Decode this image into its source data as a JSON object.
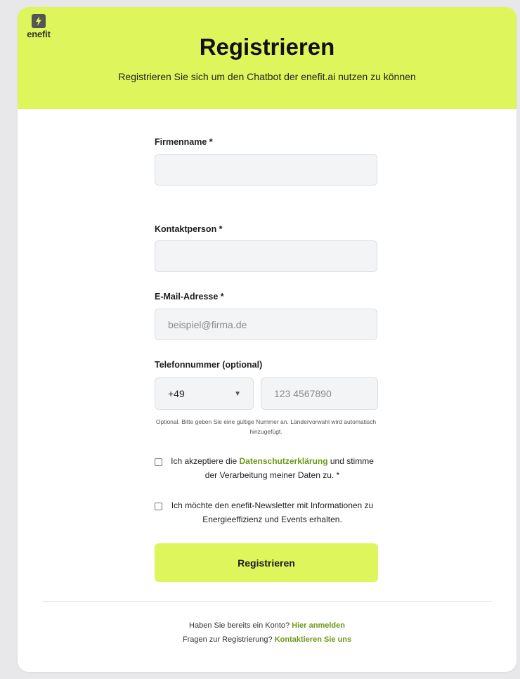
{
  "brand": {
    "logo_text": "enefit"
  },
  "header": {
    "title": "Registrieren",
    "subtitle": "Registrieren Sie sich um den Chatbot der enefit.ai nutzen zu können"
  },
  "form": {
    "company": {
      "label": "Firmenname *",
      "value": "",
      "placeholder": ""
    },
    "contact": {
      "label": "Kontaktperson *",
      "value": "",
      "placeholder": ""
    },
    "email": {
      "label": "E-Mail-Adresse *",
      "value": "",
      "placeholder": "beispiel@firma.de"
    },
    "phone": {
      "label": "Telefonnummer (optional)",
      "country_code": "+49",
      "value": "",
      "placeholder": "123 4567890",
      "hint": "Optional. Bitte geben Sie eine gültige Nummer an. Ländervorwahl wird automatisch hinzugefügt."
    },
    "privacy_consent": {
      "checked": false,
      "text_before": "Ich akzeptiere die ",
      "link_text": "Datenschutzerklärung",
      "text_after": " und stimme der Verarbeitung meiner Daten zu. *"
    },
    "newsletter_consent": {
      "checked": false,
      "text": "Ich möchte den enefit-Newsletter mit Informationen zu Energieeffizienz und Events erhalten."
    },
    "submit_label": "Registrieren"
  },
  "footer": {
    "login_prompt": "Haben Sie bereits ein Konto? ",
    "login_link": "Hier anmelden",
    "contact_prompt": "Fragen zur Registrierung? ",
    "contact_link": "Kontaktieren Sie uns"
  },
  "colors": {
    "accent": "#def65b",
    "link": "#6b9a15",
    "input_bg": "#f3f4f6"
  }
}
